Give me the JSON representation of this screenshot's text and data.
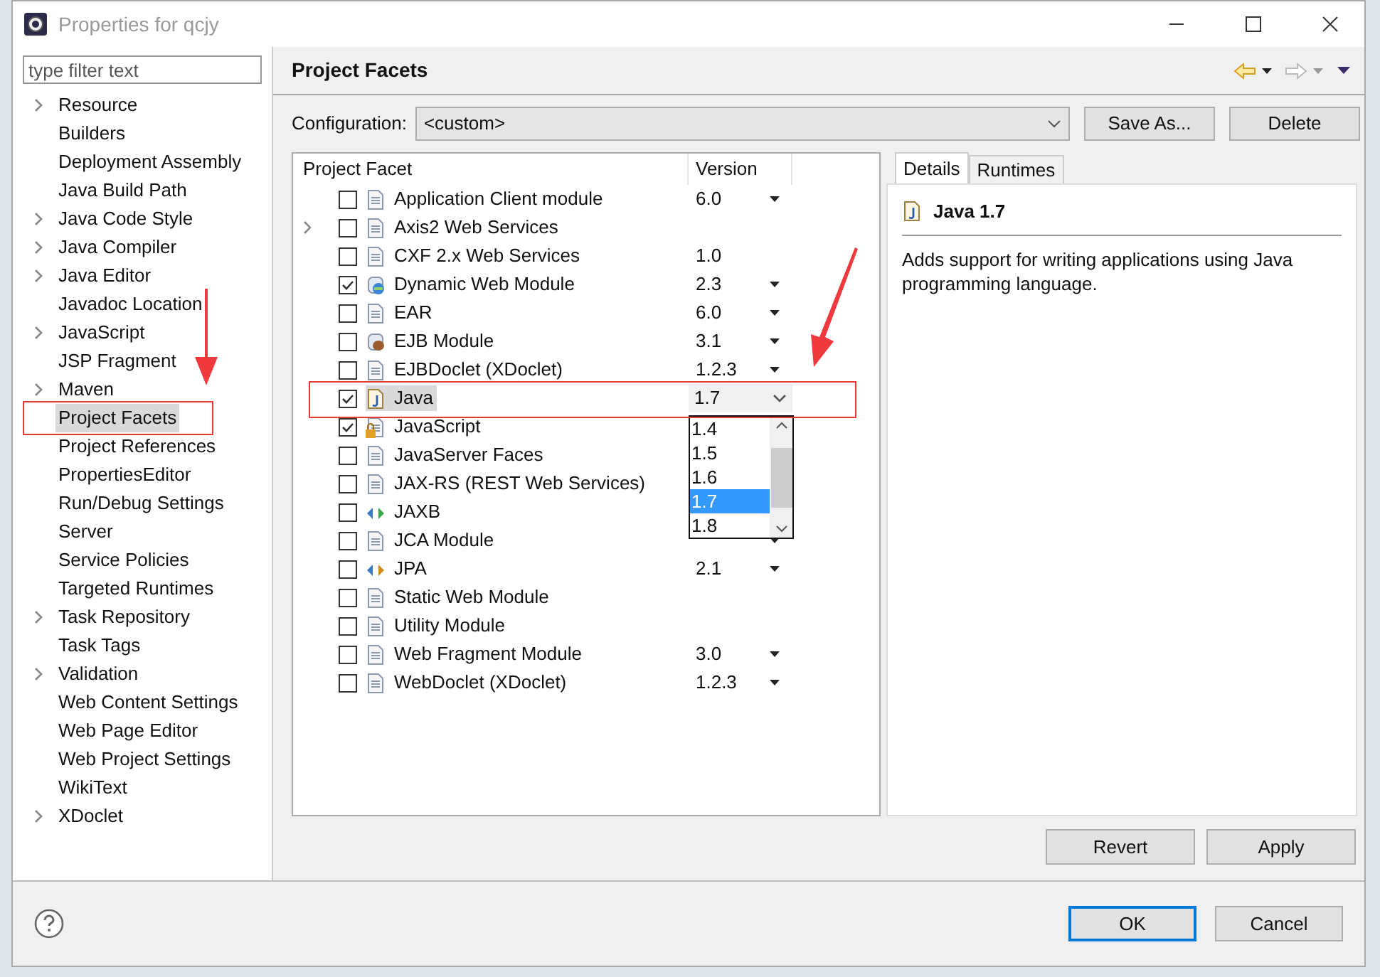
{
  "window": {
    "title": "Properties for qcjy"
  },
  "filter": {
    "placeholder": "type filter text"
  },
  "sidebar": {
    "items": [
      {
        "label": "Resource",
        "expandable": true,
        "selected": false
      },
      {
        "label": "Builders",
        "expandable": false,
        "selected": false
      },
      {
        "label": "Deployment Assembly",
        "expandable": false,
        "selected": false
      },
      {
        "label": "Java Build Path",
        "expandable": false,
        "selected": false
      },
      {
        "label": "Java Code Style",
        "expandable": true,
        "selected": false
      },
      {
        "label": "Java Compiler",
        "expandable": true,
        "selected": false
      },
      {
        "label": "Java Editor",
        "expandable": true,
        "selected": false
      },
      {
        "label": "Javadoc Location",
        "expandable": false,
        "selected": false
      },
      {
        "label": "JavaScript",
        "expandable": true,
        "selected": false
      },
      {
        "label": "JSP Fragment",
        "expandable": false,
        "selected": false
      },
      {
        "label": "Maven",
        "expandable": true,
        "selected": false
      },
      {
        "label": "Project Facets",
        "expandable": false,
        "selected": true
      },
      {
        "label": "Project References",
        "expandable": false,
        "selected": false
      },
      {
        "label": "PropertiesEditor",
        "expandable": false,
        "selected": false
      },
      {
        "label": "Run/Debug Settings",
        "expandable": false,
        "selected": false
      },
      {
        "label": "Server",
        "expandable": false,
        "selected": false
      },
      {
        "label": "Service Policies",
        "expandable": false,
        "selected": false
      },
      {
        "label": "Targeted Runtimes",
        "expandable": false,
        "selected": false
      },
      {
        "label": "Task Repository",
        "expandable": true,
        "selected": false
      },
      {
        "label": "Task Tags",
        "expandable": false,
        "selected": false
      },
      {
        "label": "Validation",
        "expandable": true,
        "selected": false
      },
      {
        "label": "Web Content Settings",
        "expandable": false,
        "selected": false
      },
      {
        "label": "Web Page Editor",
        "expandable": false,
        "selected": false
      },
      {
        "label": "Web Project Settings",
        "expandable": false,
        "selected": false
      },
      {
        "label": "WikiText",
        "expandable": false,
        "selected": false
      },
      {
        "label": "XDoclet",
        "expandable": true,
        "selected": false
      }
    ]
  },
  "page": {
    "title": "Project Facets"
  },
  "configuration": {
    "label": "Configuration:",
    "value": "<custom>",
    "buttons": [
      "Save As...",
      "Delete"
    ]
  },
  "table": {
    "columns": [
      "Project Facet",
      "Version"
    ],
    "rows": [
      {
        "facet": "Application Client module",
        "kind": "doc",
        "checked": false,
        "expandable": false,
        "selected": false,
        "version": "6.0",
        "has_dropdown": true
      },
      {
        "facet": "Axis2 Web Services",
        "kind": "doc",
        "checked": false,
        "expandable": true,
        "selected": false
      },
      {
        "facet": "CXF 2.x Web Services",
        "kind": "doc",
        "checked": false,
        "expandable": false,
        "selected": false,
        "version": "1.0",
        "has_dropdown": false
      },
      {
        "facet": "Dynamic Web Module",
        "kind": "globe",
        "checked": true,
        "expandable": false,
        "selected": false,
        "version": "2.3",
        "has_dropdown": true
      },
      {
        "facet": "EAR",
        "kind": "doc",
        "checked": false,
        "expandable": false,
        "selected": false,
        "version": "6.0",
        "has_dropdown": true
      },
      {
        "facet": "EJB Module",
        "kind": "bean",
        "checked": false,
        "expandable": false,
        "selected": false,
        "version": "3.1",
        "has_dropdown": true
      },
      {
        "facet": "EJBDoclet (XDoclet)",
        "kind": "doc",
        "checked": false,
        "expandable": false,
        "selected": false,
        "version": "1.2.3",
        "has_dropdown": true
      },
      {
        "facet": "Java",
        "kind": "java",
        "checked": true,
        "expandable": false,
        "selected": true,
        "version": "1.7",
        "has_dropdown": true
      },
      {
        "facet": "JavaScript",
        "kind": "locked",
        "checked": true,
        "expandable": false,
        "selected": false
      },
      {
        "facet": "JavaServer Faces",
        "kind": "doc",
        "checked": false,
        "expandable": false,
        "selected": false
      },
      {
        "facet": "JAX-RS (REST Web Services)",
        "kind": "doc",
        "checked": false,
        "expandable": false,
        "selected": false
      },
      {
        "facet": "JAXB",
        "kind": "arrows-green",
        "checked": false,
        "expandable": false,
        "selected": false
      },
      {
        "facet": "JCA Module",
        "kind": "doc",
        "checked": false,
        "expandable": false,
        "selected": false,
        "has_dropdown": true
      },
      {
        "facet": "JPA",
        "kind": "arrows-orange",
        "checked": false,
        "expandable": false,
        "selected": false,
        "version": "2.1",
        "has_dropdown": true
      },
      {
        "facet": "Static Web Module",
        "kind": "doc",
        "checked": false,
        "expandable": false,
        "selected": false
      },
      {
        "facet": "Utility Module",
        "kind": "doc",
        "checked": false,
        "expandable": false,
        "selected": false
      },
      {
        "facet": "Web Fragment Module",
        "kind": "doc",
        "checked": false,
        "expandable": false,
        "selected": false,
        "version": "3.0",
        "has_dropdown": true
      },
      {
        "facet": "WebDoclet (XDoclet)",
        "kind": "doc",
        "checked": false,
        "expandable": false,
        "selected": false,
        "version": "1.2.3",
        "has_dropdown": true
      }
    ]
  },
  "version_dropdown": {
    "options": [
      {
        "label": "1.4",
        "selected": false
      },
      {
        "label": "1.5",
        "selected": false
      },
      {
        "label": "1.6",
        "selected": false
      },
      {
        "label": "1.7",
        "selected": true
      },
      {
        "label": "1.8",
        "selected": false
      }
    ]
  },
  "details": {
    "tabs": [
      {
        "label": "Details",
        "selected": true
      },
      {
        "label": "Runtimes",
        "selected": false
      }
    ],
    "title": "Java 1.7",
    "description": "Adds support for writing applications using Java programming language."
  },
  "page_buttons": [
    "Revert",
    "Apply"
  ],
  "dialog_buttons": [
    {
      "label": "OK",
      "default": true
    },
    {
      "label": "Cancel",
      "default": false
    }
  ]
}
